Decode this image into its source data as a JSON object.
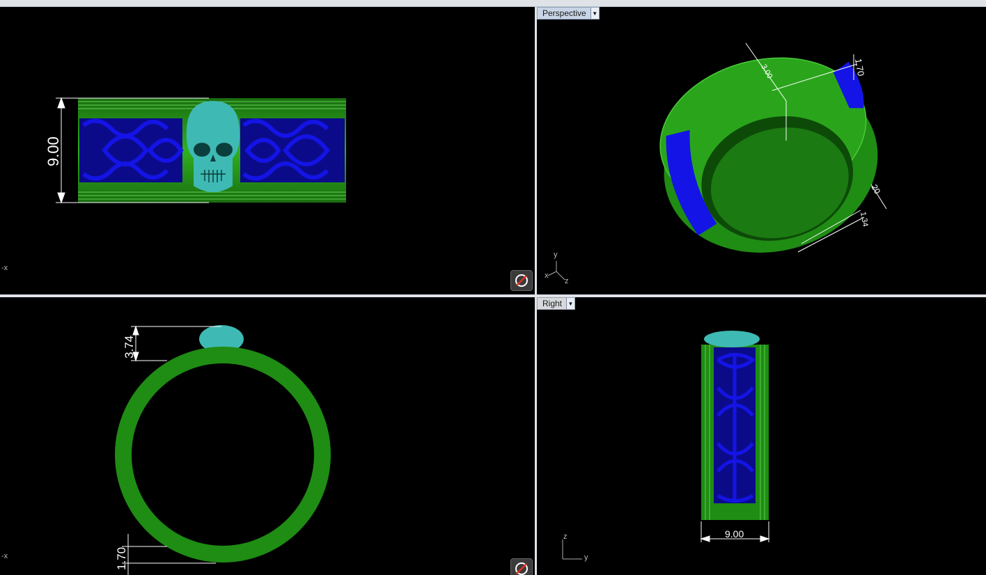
{
  "viewports": {
    "perspective": {
      "title": "Perspective",
      "dims": [
        "1.70",
        "3.00",
        "20",
        "1.34"
      ]
    },
    "right": {
      "title": "Right",
      "width_dim": "9.00"
    },
    "front": {
      "height_dim": "9.00",
      "axis": "-x"
    },
    "top": {
      "top_dim": "3.74",
      "bottom_dim": "1.70",
      "axis": "-x"
    }
  },
  "axes": {
    "persp": [
      "y",
      "x",
      "z"
    ],
    "right": [
      "z",
      "y"
    ]
  },
  "colors": {
    "ring": "#1f8c14",
    "ornament": "#1010d8",
    "skull": "#3fb9b4",
    "background": "#000000"
  },
  "icons": {
    "nav": "rotate-view-icon",
    "dropdown": "chevron-down-icon"
  }
}
